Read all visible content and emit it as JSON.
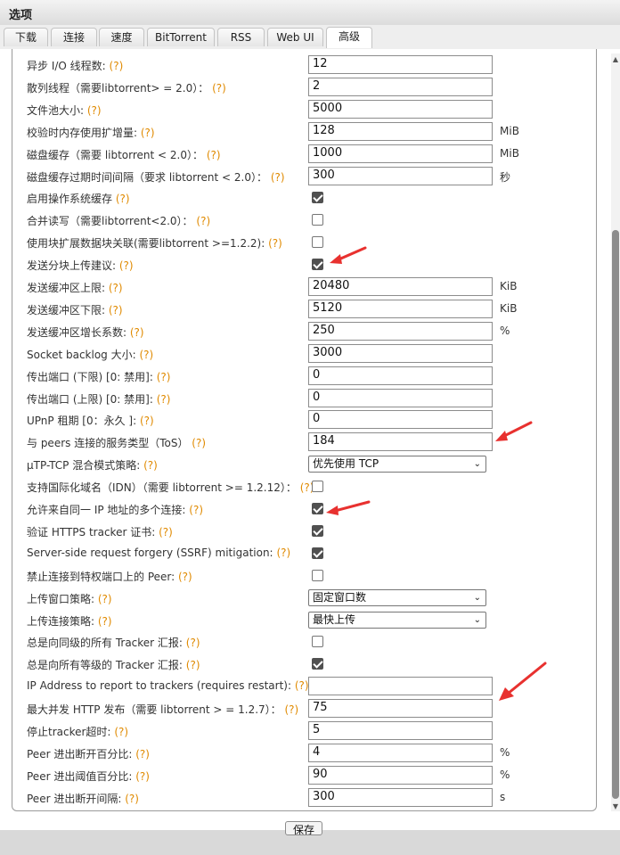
{
  "window": {
    "title": "选项"
  },
  "tabs": [
    {
      "label": "下载"
    },
    {
      "label": "连接"
    },
    {
      "label": "速度"
    },
    {
      "label": "BitTorrent"
    },
    {
      "label": "RSS"
    },
    {
      "label": "Web UI"
    },
    {
      "label": "高级"
    }
  ],
  "settings": [
    {
      "label": "异步 I/O 线程数:",
      "help": "(?)",
      "value": "12"
    },
    {
      "label": "散列线程（需要libtorrent> = 2.0）：",
      "help": "(?)",
      "value": "2"
    },
    {
      "label": "文件池大小:",
      "help": "(?)",
      "value": "5000"
    },
    {
      "label": "校验时内存使用扩增量:",
      "help": "(?)",
      "value": "128",
      "unit": "MiB"
    },
    {
      "label": "磁盘缓存（需要 libtorrent < 2.0）：",
      "help": "(?)",
      "value": "1000",
      "unit": "MiB"
    },
    {
      "label": "磁盘缓存过期时间间隔（要求 libtorrent < 2.0）：",
      "help": "(?)",
      "value": "300",
      "unit": "秒"
    },
    {
      "label": "启用操作系统缓存",
      "help": "(?)",
      "checked": true
    },
    {
      "label": "合并读写（需要libtorrent<2.0）：",
      "help": "(?)",
      "checked": false
    },
    {
      "label": "使用块扩展数据块关联(需要libtorrent >=1.2.2):",
      "help": "(?)",
      "checked": false
    },
    {
      "label": "发送分块上传建议:",
      "help": "(?)",
      "checked": true
    },
    {
      "label": "发送缓冲区上限:",
      "help": "(?)",
      "value": "20480",
      "unit": "KiB"
    },
    {
      "label": "发送缓冲区下限:",
      "help": "(?)",
      "value": "5120",
      "unit": "KiB"
    },
    {
      "label": "发送缓冲区增长系数:",
      "help": "(?)",
      "value": "250",
      "unit": "%"
    },
    {
      "label": "Socket backlog 大小:",
      "help": "(?)",
      "value": "3000"
    },
    {
      "label": "传出端口 (下限) [0: 禁用]:",
      "help": "(?)",
      "value": "0"
    },
    {
      "label": "传出端口 (上限) [0: 禁用]:",
      "help": "(?)",
      "value": "0"
    },
    {
      "label": "UPnP 租期 [0：永久 ]:",
      "help": "(?)",
      "value": "0"
    },
    {
      "label": "与 peers 连接的服务类型（ToS）",
      "help": "(?)",
      "value": "184"
    },
    {
      "label": "μTP-TCP 混合模式策略:",
      "help": "(?)",
      "select": "优先使用 TCP"
    },
    {
      "label": "支持国际化域名（IDN）（需要 libtorrent >= 1.2.12）：",
      "help": "(?)",
      "checked": false
    },
    {
      "label": "允许来自同一 IP 地址的多个连接:",
      "help": "(?)",
      "checked": true
    },
    {
      "label": "验证 HTTPS tracker 证书:",
      "help": "(?)",
      "checked": true
    },
    {
      "label": "Server-side request forgery (SSRF) mitigation:",
      "help": "(?)",
      "checked": true
    },
    {
      "label": "禁止连接到特权端口上的 Peer:",
      "help": "(?)",
      "checked": false
    },
    {
      "label": "上传窗口策略:",
      "help": "(?)",
      "select": "固定窗口数"
    },
    {
      "label": "上传连接策略:",
      "help": "(?)",
      "select": "最快上传"
    },
    {
      "label": "总是向同级的所有 Tracker 汇报:",
      "help": "(?)",
      "checked": false
    },
    {
      "label": "总是向所有等级的 Tracker 汇报:",
      "help": "(?)",
      "checked": true
    },
    {
      "label": "IP Address to report to trackers (requires restart):",
      "help": "(?)",
      "value": ""
    },
    {
      "label": "最大并发 HTTP 发布（需要 libtorrent > = 1.2.7）：",
      "help": "(?)",
      "value": "75"
    },
    {
      "label": "停止tracker超时:",
      "help": "(?)",
      "value": "5"
    },
    {
      "label": "Peer 进出断开百分比:",
      "help": "(?)",
      "value": "4",
      "unit": "%"
    },
    {
      "label": "Peer 进出阈值百分比:",
      "help": "(?)",
      "value": "90",
      "unit": "%"
    },
    {
      "label": "Peer 进出断开间隔:",
      "help": "(?)",
      "value": "300",
      "unit": "s"
    }
  ],
  "footer": {
    "save_label": "保存"
  }
}
